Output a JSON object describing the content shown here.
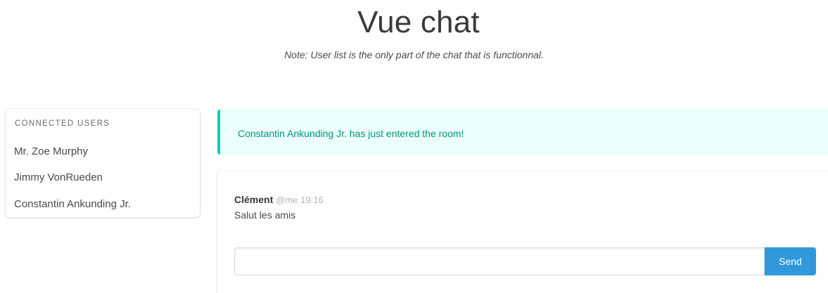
{
  "header": {
    "title": "Vue chat",
    "note": "Note: User list is the only part of the chat that is functionnal."
  },
  "users": {
    "heading": "CONNECTED USERS",
    "items": [
      "Mr. Zoe Murphy",
      "Jimmy VonRueden",
      "Constantin Ankunding Jr."
    ]
  },
  "notification": {
    "text": "Constantin Ankunding Jr. has just entered the room!"
  },
  "messages": [
    {
      "author": "Clément",
      "handle": "@me",
      "time": "19:16",
      "text": "Salut les amis"
    }
  ],
  "composer": {
    "value": "",
    "placeholder": "",
    "send_label": "Send"
  },
  "colors": {
    "accent": "#3298dc",
    "notification_border": "#00d1b2",
    "notification_bg": "#ebfffc",
    "notification_text": "#00947e"
  }
}
